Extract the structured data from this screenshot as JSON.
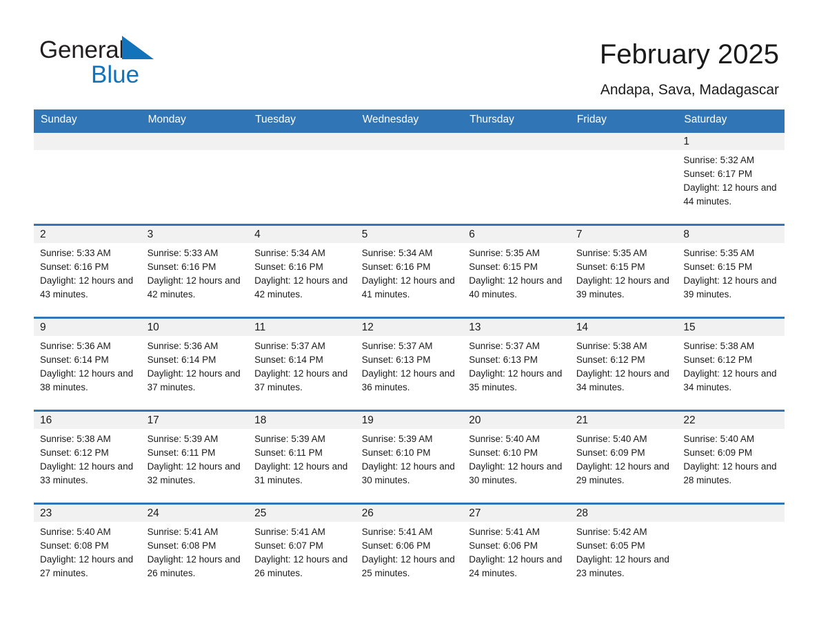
{
  "brand": {
    "word_general": "General",
    "word_blue": "Blue",
    "flag_icon": "triangle-flag-icon",
    "blue_hex": "#1273bb",
    "dark_hex": "#231f20"
  },
  "header": {
    "title": "February 2025",
    "subtitle": "Andapa, Sava, Madagascar"
  },
  "theme": {
    "header_blue": "#3075b5",
    "daynum_band": "#f1f1f1",
    "text": "#1a1a1a"
  },
  "weekday_headers": [
    "Sunday",
    "Monday",
    "Tuesday",
    "Wednesday",
    "Thursday",
    "Friday",
    "Saturday"
  ],
  "labels": {
    "sunrise_prefix": "Sunrise:",
    "sunset_prefix": "Sunset:",
    "daylight_prefix": "Daylight:"
  },
  "weeks": [
    [
      {
        "empty": true
      },
      {
        "empty": true
      },
      {
        "empty": true
      },
      {
        "empty": true
      },
      {
        "empty": true
      },
      {
        "empty": true
      },
      {
        "day": "1",
        "sunrise": "Sunrise: 5:32 AM",
        "sunset": "Sunset: 6:17 PM",
        "daylight": "Daylight: 12 hours and 44 minutes."
      }
    ],
    [
      {
        "day": "2",
        "sunrise": "Sunrise: 5:33 AM",
        "sunset": "Sunset: 6:16 PM",
        "daylight": "Daylight: 12 hours and 43 minutes."
      },
      {
        "day": "3",
        "sunrise": "Sunrise: 5:33 AM",
        "sunset": "Sunset: 6:16 PM",
        "daylight": "Daylight: 12 hours and 42 minutes."
      },
      {
        "day": "4",
        "sunrise": "Sunrise: 5:34 AM",
        "sunset": "Sunset: 6:16 PM",
        "daylight": "Daylight: 12 hours and 42 minutes."
      },
      {
        "day": "5",
        "sunrise": "Sunrise: 5:34 AM",
        "sunset": "Sunset: 6:16 PM",
        "daylight": "Daylight: 12 hours and 41 minutes."
      },
      {
        "day": "6",
        "sunrise": "Sunrise: 5:35 AM",
        "sunset": "Sunset: 6:15 PM",
        "daylight": "Daylight: 12 hours and 40 minutes."
      },
      {
        "day": "7",
        "sunrise": "Sunrise: 5:35 AM",
        "sunset": "Sunset: 6:15 PM",
        "daylight": "Daylight: 12 hours and 39 minutes."
      },
      {
        "day": "8",
        "sunrise": "Sunrise: 5:35 AM",
        "sunset": "Sunset: 6:15 PM",
        "daylight": "Daylight: 12 hours and 39 minutes."
      }
    ],
    [
      {
        "day": "9",
        "sunrise": "Sunrise: 5:36 AM",
        "sunset": "Sunset: 6:14 PM",
        "daylight": "Daylight: 12 hours and 38 minutes."
      },
      {
        "day": "10",
        "sunrise": "Sunrise: 5:36 AM",
        "sunset": "Sunset: 6:14 PM",
        "daylight": "Daylight: 12 hours and 37 minutes."
      },
      {
        "day": "11",
        "sunrise": "Sunrise: 5:37 AM",
        "sunset": "Sunset: 6:14 PM",
        "daylight": "Daylight: 12 hours and 37 minutes."
      },
      {
        "day": "12",
        "sunrise": "Sunrise: 5:37 AM",
        "sunset": "Sunset: 6:13 PM",
        "daylight": "Daylight: 12 hours and 36 minutes."
      },
      {
        "day": "13",
        "sunrise": "Sunrise: 5:37 AM",
        "sunset": "Sunset: 6:13 PM",
        "daylight": "Daylight: 12 hours and 35 minutes."
      },
      {
        "day": "14",
        "sunrise": "Sunrise: 5:38 AM",
        "sunset": "Sunset: 6:12 PM",
        "daylight": "Daylight: 12 hours and 34 minutes."
      },
      {
        "day": "15",
        "sunrise": "Sunrise: 5:38 AM",
        "sunset": "Sunset: 6:12 PM",
        "daylight": "Daylight: 12 hours and 34 minutes."
      }
    ],
    [
      {
        "day": "16",
        "sunrise": "Sunrise: 5:38 AM",
        "sunset": "Sunset: 6:12 PM",
        "daylight": "Daylight: 12 hours and 33 minutes."
      },
      {
        "day": "17",
        "sunrise": "Sunrise: 5:39 AM",
        "sunset": "Sunset: 6:11 PM",
        "daylight": "Daylight: 12 hours and 32 minutes."
      },
      {
        "day": "18",
        "sunrise": "Sunrise: 5:39 AM",
        "sunset": "Sunset: 6:11 PM",
        "daylight": "Daylight: 12 hours and 31 minutes."
      },
      {
        "day": "19",
        "sunrise": "Sunrise: 5:39 AM",
        "sunset": "Sunset: 6:10 PM",
        "daylight": "Daylight: 12 hours and 30 minutes."
      },
      {
        "day": "20",
        "sunrise": "Sunrise: 5:40 AM",
        "sunset": "Sunset: 6:10 PM",
        "daylight": "Daylight: 12 hours and 30 minutes."
      },
      {
        "day": "21",
        "sunrise": "Sunrise: 5:40 AM",
        "sunset": "Sunset: 6:09 PM",
        "daylight": "Daylight: 12 hours and 29 minutes."
      },
      {
        "day": "22",
        "sunrise": "Sunrise: 5:40 AM",
        "sunset": "Sunset: 6:09 PM",
        "daylight": "Daylight: 12 hours and 28 minutes."
      }
    ],
    [
      {
        "day": "23",
        "sunrise": "Sunrise: 5:40 AM",
        "sunset": "Sunset: 6:08 PM",
        "daylight": "Daylight: 12 hours and 27 minutes."
      },
      {
        "day": "24",
        "sunrise": "Sunrise: 5:41 AM",
        "sunset": "Sunset: 6:08 PM",
        "daylight": "Daylight: 12 hours and 26 minutes."
      },
      {
        "day": "25",
        "sunrise": "Sunrise: 5:41 AM",
        "sunset": "Sunset: 6:07 PM",
        "daylight": "Daylight: 12 hours and 26 minutes."
      },
      {
        "day": "26",
        "sunrise": "Sunrise: 5:41 AM",
        "sunset": "Sunset: 6:06 PM",
        "daylight": "Daylight: 12 hours and 25 minutes."
      },
      {
        "day": "27",
        "sunrise": "Sunrise: 5:41 AM",
        "sunset": "Sunset: 6:06 PM",
        "daylight": "Daylight: 12 hours and 24 minutes."
      },
      {
        "day": "28",
        "sunrise": "Sunrise: 5:42 AM",
        "sunset": "Sunset: 6:05 PM",
        "daylight": "Daylight: 12 hours and 23 minutes."
      },
      {
        "empty": true
      }
    ]
  ]
}
